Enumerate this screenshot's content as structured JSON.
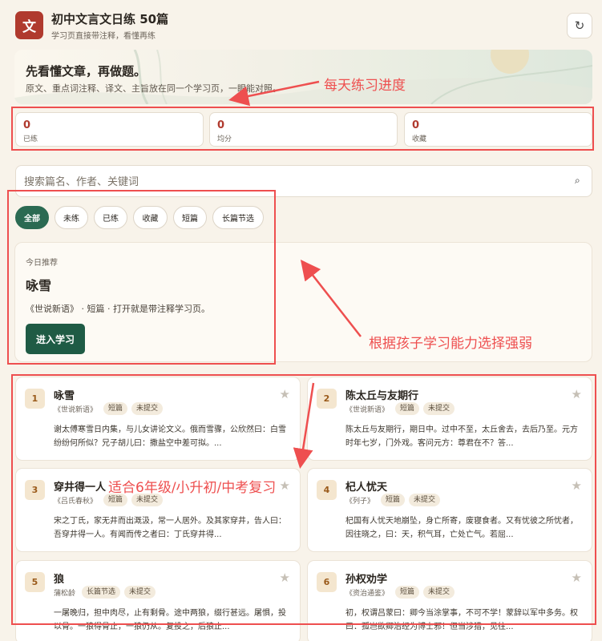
{
  "header": {
    "logo_char": "文",
    "title": "初中文言文日练 50篇",
    "subtitle": "学习页直接带注释，看懂再练",
    "refresh_icon": "refresh-icon"
  },
  "hero": {
    "title": "先看懂文章，再做题。",
    "description": "原文、重点词注释、译文、主旨放在同一个学习页，一眼能对照。"
  },
  "stats": [
    {
      "value": "0",
      "label": "已练"
    },
    {
      "value": "0",
      "label": "均分"
    },
    {
      "value": "0",
      "label": "收藏"
    }
  ],
  "search": {
    "placeholder": "搜索篇名、作者、关键词",
    "value": ""
  },
  "filters": [
    {
      "label": "全部",
      "active": true
    },
    {
      "label": "未练",
      "active": false
    },
    {
      "label": "已练",
      "active": false
    },
    {
      "label": "收藏",
      "active": false
    },
    {
      "label": "短篇",
      "active": false
    },
    {
      "label": "长篇节选",
      "active": false
    }
  ],
  "recommend": {
    "label": "今日推荐",
    "title": "咏雪",
    "description": "《世说新语》 · 短篇 · 打开就是带注释学习页。",
    "button": "进入学习"
  },
  "lessons": [
    {
      "num": "1",
      "title": "咏雪",
      "source": "《世说新语》",
      "tags": [
        "短篇",
        "未提交"
      ],
      "excerpt": "谢太傅寒雪日内集，与儿女讲论文义。俄而雪骤，公欣然曰：白雪纷纷何所似？兄子胡儿曰：撒盐空中差可拟。..."
    },
    {
      "num": "2",
      "title": "陈太丘与友期行",
      "source": "《世说新语》",
      "tags": [
        "短篇",
        "未提交"
      ],
      "excerpt": "陈太丘与友期行，期日中。过中不至，太丘舍去，去后乃至。元方时年七岁，门外戏。客问元方：尊君在不？答..."
    },
    {
      "num": "3",
      "title": "穿井得一人",
      "source": "《吕氏春秋》",
      "tags": [
        "短篇",
        "未提交"
      ],
      "excerpt": "宋之丁氏，家无井而出溉汲，常一人居外。及其家穿井，告人曰：吾穿井得一人。有闻而传之者曰：丁氏穿井得..."
    },
    {
      "num": "4",
      "title": "杞人忧天",
      "source": "《列子》",
      "tags": [
        "短篇",
        "未提交"
      ],
      "excerpt": "杞国有人忧天地崩坠，身亡所寄，废寝食者。又有忧彼之所忧者，因往晓之，曰：天，积气耳，亡处亡气。若屈..."
    },
    {
      "num": "5",
      "title": "狼",
      "source": "蒲松龄",
      "tags": [
        "长篇节选",
        "未提交"
      ],
      "excerpt": "一屠晚归，担中肉尽，止有剩骨。途中两狼，缀行甚远。屠惧，投以骨。一狼得骨止，一狼仍从。复投之，后狼止..."
    },
    {
      "num": "6",
      "title": "孙权劝学",
      "source": "《资治通鉴》",
      "tags": [
        "短篇",
        "未提交"
      ],
      "excerpt": "初，权谓吕蒙曰：卿今当涂掌事，不可不学！蒙辞以军中多务。权曰：孤岂欲卿治经为博士邪！但当涉猎，见往..."
    }
  ],
  "annotations": {
    "progress_note": "每天练习进度",
    "level_note": "根据孩子学习能力选择强弱",
    "grade_note": "适合6年级/小升初/中考复习",
    "color": "#ee4f4f"
  }
}
